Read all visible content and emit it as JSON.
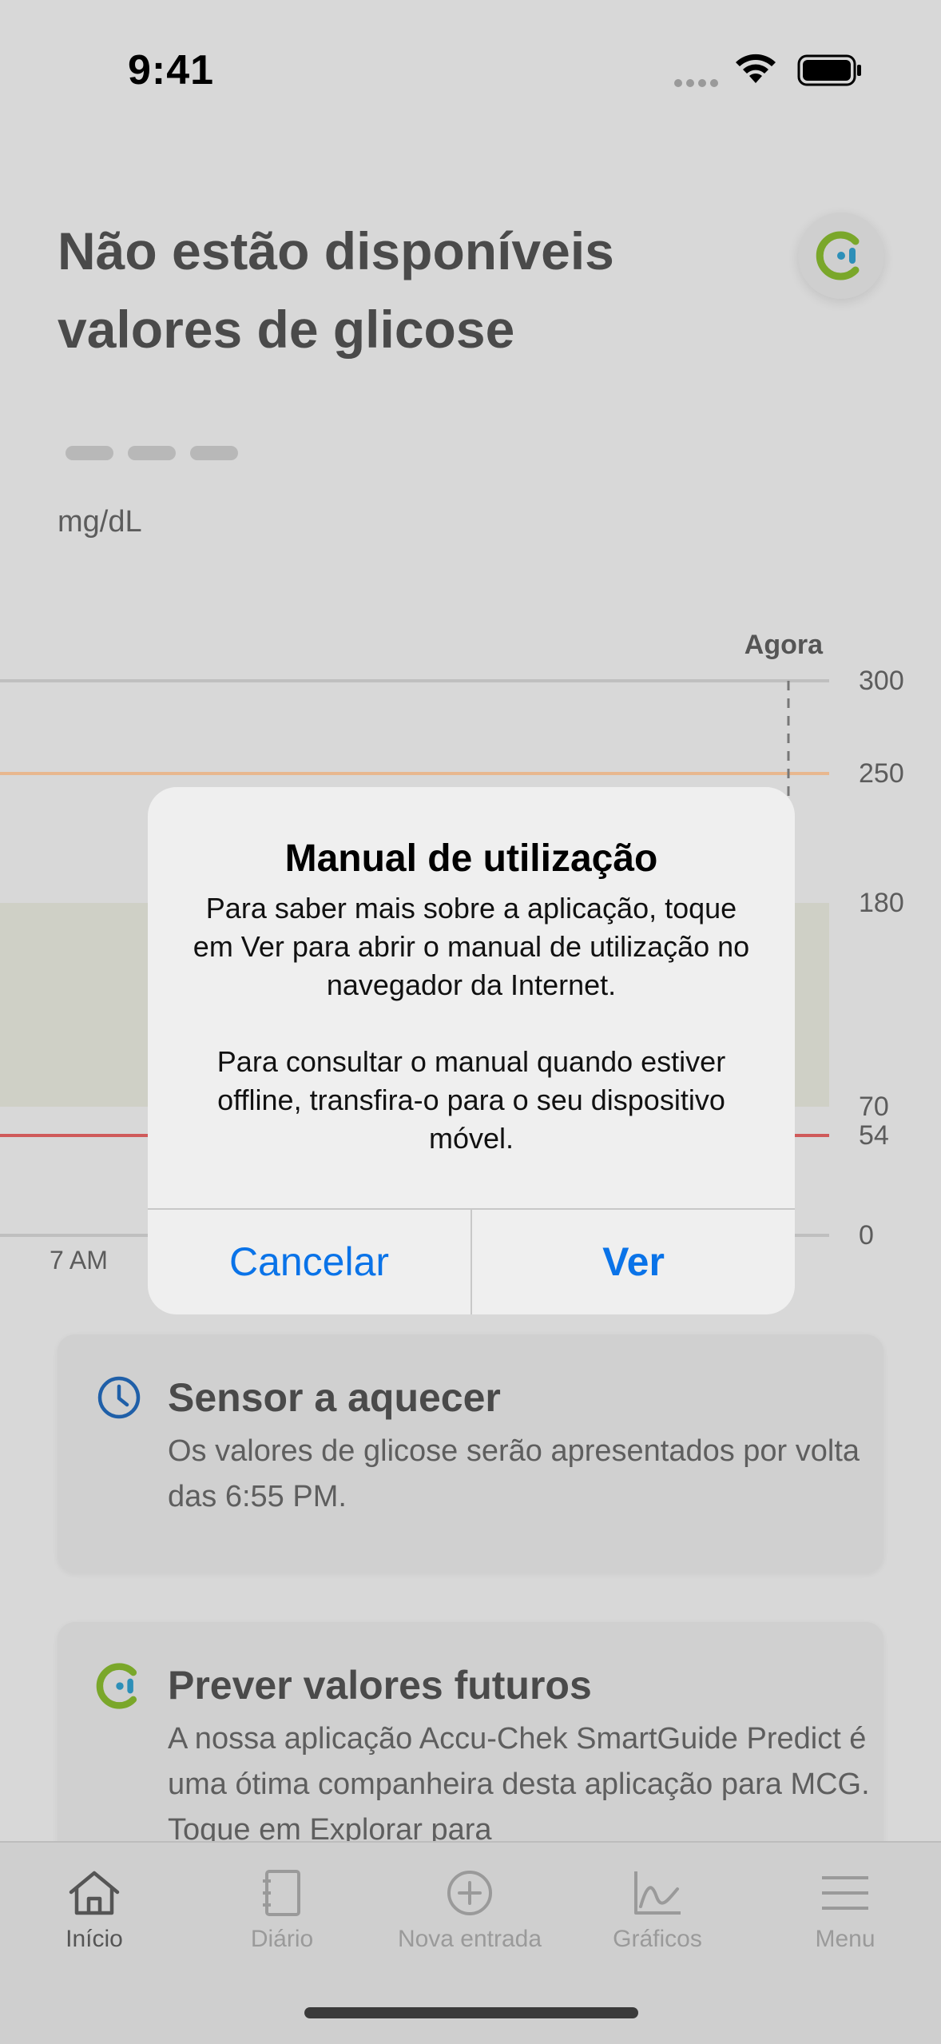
{
  "status_bar": {
    "time": "9:41"
  },
  "header": {
    "title": "Não estão disponíveis valores de glicose",
    "unit": "mg/dL"
  },
  "chart": {
    "now_label": "Agora",
    "y_ticks": [
      "300",
      "250",
      "180",
      "70",
      "54",
      "0"
    ],
    "x_ticks": [
      "7 AM"
    ],
    "colors": {
      "target_band": "#cfd0c6",
      "high_line": "#e8b78f",
      "low_line": "#cf5a5a",
      "grid": "#bfbfbf"
    }
  },
  "cards": [
    {
      "icon": "clock-icon",
      "title": "Sensor a aquecer",
      "body": "Os valores de glicose serão apresentados por volta das 6:55 PM."
    },
    {
      "icon": "smartguide-logo-icon",
      "title": "Prever valores futuros",
      "body": "A nossa aplicação Accu-Chek SmartGuide Predict é uma ótima companheira desta aplicação para MCG. Toque em Explorar para"
    }
  ],
  "dialog": {
    "title": "Manual de utilização",
    "message_1": "Para saber mais sobre a aplicação, toque em Ver para abrir o manual de utilização no navegador da Internet.",
    "message_2": "Para consultar o manual quando estiver offline, transfira-o para o seu dispositivo móvel.",
    "cancel_label": "Cancelar",
    "view_label": "Ver",
    "accent": "#0a73e8"
  },
  "tabs": [
    {
      "label": "Início",
      "icon": "home-icon",
      "active": true
    },
    {
      "label": "Diário",
      "icon": "diary-icon",
      "active": false
    },
    {
      "label": "Nova entrada",
      "icon": "plus-circle-icon",
      "active": false
    },
    {
      "label": "Gráficos",
      "icon": "graph-icon",
      "active": false
    },
    {
      "label": "Menu",
      "icon": "menu-icon",
      "active": false
    }
  ]
}
